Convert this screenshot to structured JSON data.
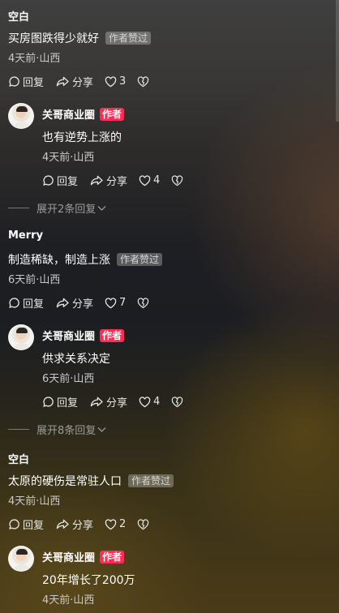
{
  "labels": {
    "reply": "回复",
    "share": "分享",
    "liked_by_author": "作者赞过",
    "author": "作者"
  },
  "threads": [
    {
      "username": "空白",
      "text": "买房图跌得少就好",
      "meta": "4天前·山西",
      "likes": "3",
      "reply": {
        "name": "关哥商业圈",
        "text": "也有逆势上涨的",
        "meta": "4天前·山西",
        "likes": "4"
      },
      "expand_label": "展开2条回复"
    },
    {
      "username": "Merry",
      "text": "制造稀缺，制造上涨",
      "meta": "6天前·山西",
      "likes": "7",
      "reply": {
        "name": "关哥商业圈",
        "text": "供求关系决定",
        "meta": "6天前·山西",
        "likes": "4"
      },
      "expand_label": "展开8条回复"
    },
    {
      "username": "空白",
      "text": "太原的硬伤是常驻人口",
      "meta": "4天前·山西",
      "likes": "2",
      "reply": {
        "name": "关哥商业圈",
        "text": "20年增长了200万",
        "meta": "4天前·山西"
      }
    }
  ]
}
